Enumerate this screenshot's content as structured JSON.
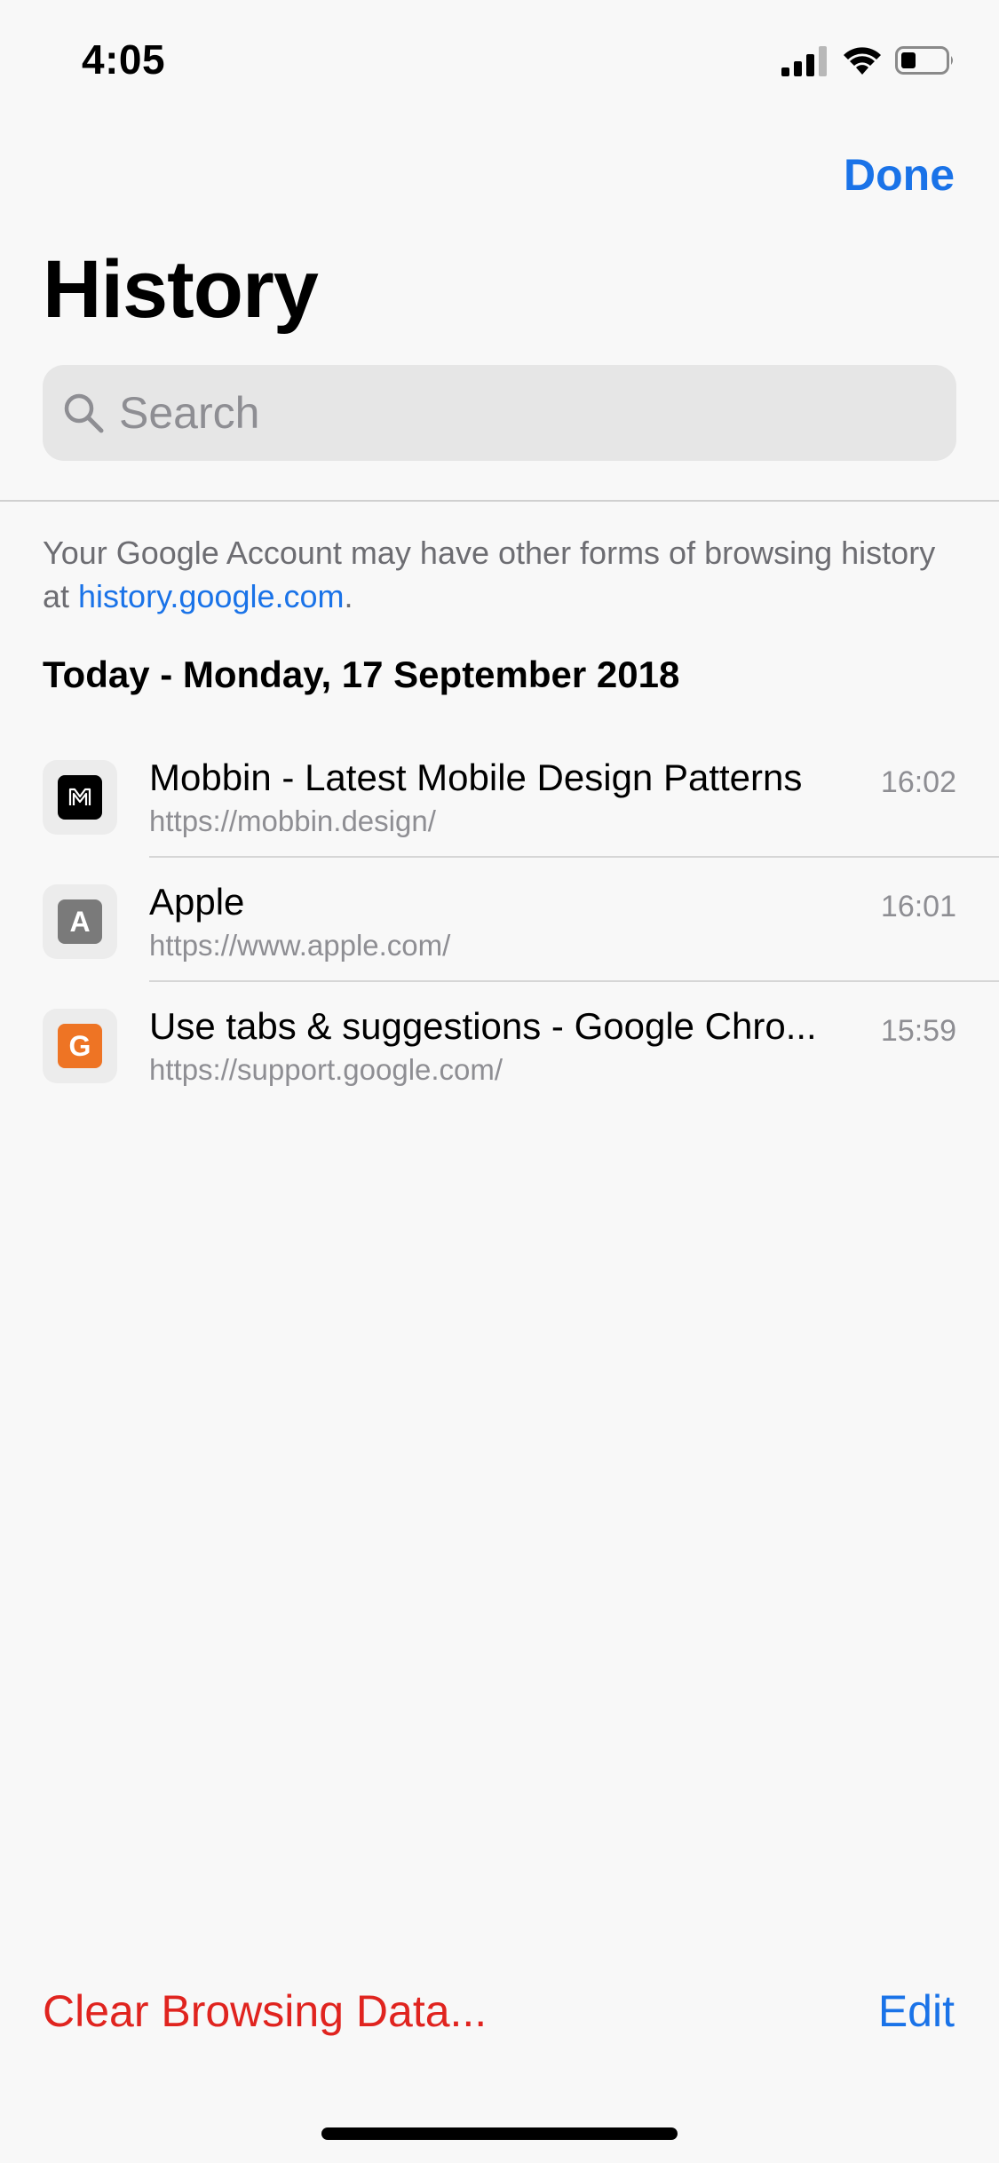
{
  "status_bar": {
    "time": "4:05",
    "signal_icon": "cellular-signal-icon",
    "wifi_icon": "wifi-icon",
    "battery_icon": "battery-icon"
  },
  "header": {
    "done_label": "Done",
    "title": "History"
  },
  "search": {
    "placeholder": "Search",
    "value": "",
    "icon": "search-icon"
  },
  "account_note": {
    "text_before": "Your Google Account may have other forms of browsing history at ",
    "link_text": "history.google.com",
    "text_after": "."
  },
  "section": {
    "header": "Today - Monday, 17 September 2018"
  },
  "history": {
    "items": [
      {
        "title": "Mobbin - Latest Mobile Design Patterns",
        "url": "https://mobbin.design/",
        "time": "16:02",
        "favicon_letter": "M",
        "favicon_icon": "mobbin-favicon-icon",
        "favicon_color": "#000000"
      },
      {
        "title": "Apple",
        "url": "https://www.apple.com/",
        "time": "16:01",
        "favicon_letter": "A",
        "favicon_icon": "apple-favicon-icon",
        "favicon_color": "#7a7a7a"
      },
      {
        "title": "Use tabs & suggestions - Google Chro...",
        "url": "https://support.google.com/",
        "time": "15:59",
        "favicon_letter": "G",
        "favicon_icon": "google-support-favicon-icon",
        "favicon_color": "#ee7424"
      }
    ]
  },
  "toolbar": {
    "clear_label": "Clear Browsing Data...",
    "edit_label": "Edit"
  },
  "colors": {
    "accent": "#1a73e8",
    "destructive": "#e0241f",
    "background": "#f8f8f8",
    "secondary_text": "#8e8e93"
  }
}
